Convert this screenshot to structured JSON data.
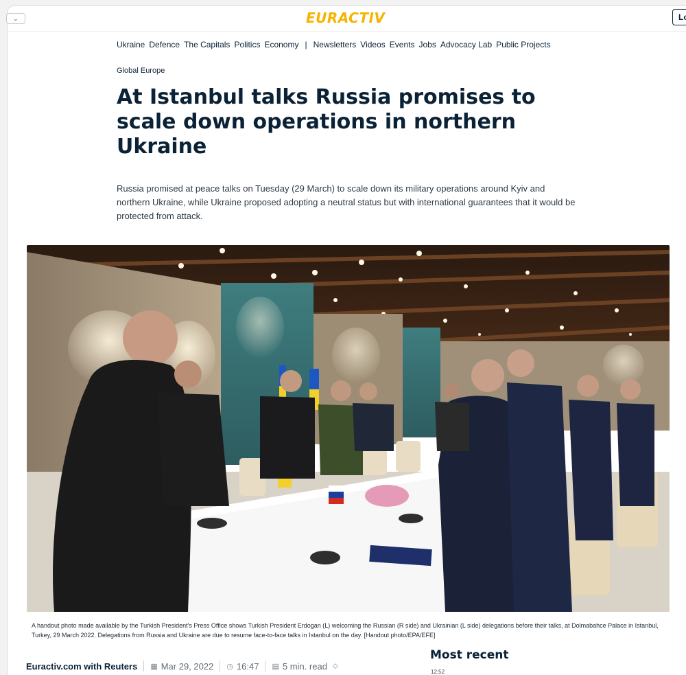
{
  "header": {
    "menu_toggle_glyph": "⌄",
    "logo": "EURACTIV",
    "login_label": "Lo"
  },
  "nav": {
    "primary": [
      "Ukraine",
      "Defence",
      "The Capitals",
      "Politics",
      "Economy"
    ],
    "separator": "|",
    "secondary": [
      "Newsletters",
      "Videos",
      "Events",
      "Jobs",
      "Advocacy Lab",
      "Public Projects"
    ]
  },
  "article": {
    "section": "Global Europe",
    "headline": "At Istanbul talks Russia promises to scale down operations in northern Ukraine",
    "lede": "Russia promised at peace talks on Tuesday (29 March) to scale down its military operations around Kyiv and northern Ukraine, while Ukraine proposed adopting a neutral status but with international guarantees that it would be protected from attack.",
    "caption": "A handout photo made available by the Turkish President's Press Office shows Turkish President Erdogan (L) welcoming the Russian (R side) and Ukrainian (L side) delegations before their talks, at Dolmabahce Palace in Istanbul, Turkey, 29 March 2022. Delegations from Russia and Ukraine are due to resume face-to-face talks in Istanbul on the day. [Handout photo/EPA/EFE]",
    "author": "Euractiv.com with Reuters",
    "date": "Mar 29, 2022",
    "time": "16:47",
    "read_time": "5 min. read"
  },
  "sidebar": {
    "most_recent_title": "Most recent",
    "first_item_time": "12:52"
  },
  "icons": {
    "calendar": "▦",
    "clock": "◷",
    "read": "▤",
    "tag": "⬦"
  },
  "colors": {
    "brand_yellow": "#f5b400",
    "navy": "#0b2236"
  }
}
